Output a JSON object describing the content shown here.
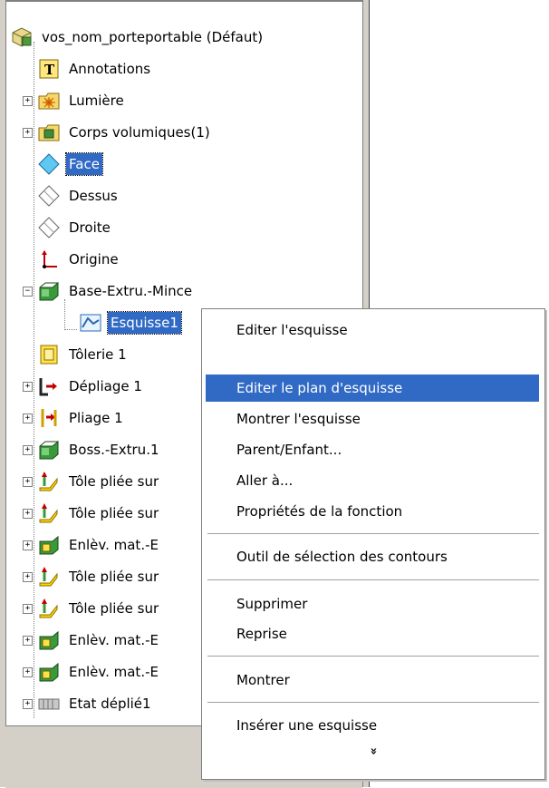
{
  "tree": {
    "root": "vos_nom_porteportable  (Défaut)",
    "items": [
      "Annotations",
      "Lumière",
      "Corps volumiques(1)",
      "Face",
      "Dessus",
      "Droite",
      "Origine",
      "Base-Extru.-Mince",
      "Esquisse1",
      "Tôlerie 1",
      "Dépliage 1",
      "Pliage 1",
      "Boss.-Extru.1",
      "Tôle pliée sur",
      "Tôle pliée sur",
      "Enlèv. mat.-E",
      "Tôle pliée sur",
      "Tôle pliée sur",
      "Enlèv. mat.-E",
      "Enlèv. mat.-E",
      "Etat déplié1"
    ]
  },
  "menu": {
    "items": [
      "Editer l'esquisse",
      "Editer le plan d'esquisse",
      "Montrer l'esquisse",
      "Parent/Enfant...",
      "Aller à...",
      "Propriétés de la fonction",
      "Outil de sélection des contours",
      "Supprimer",
      "Reprise",
      "Montrer",
      "Insérer une esquisse"
    ],
    "more": "»"
  },
  "colors": {
    "selection": "#316ac5",
    "frame": "#d4d0c8"
  }
}
